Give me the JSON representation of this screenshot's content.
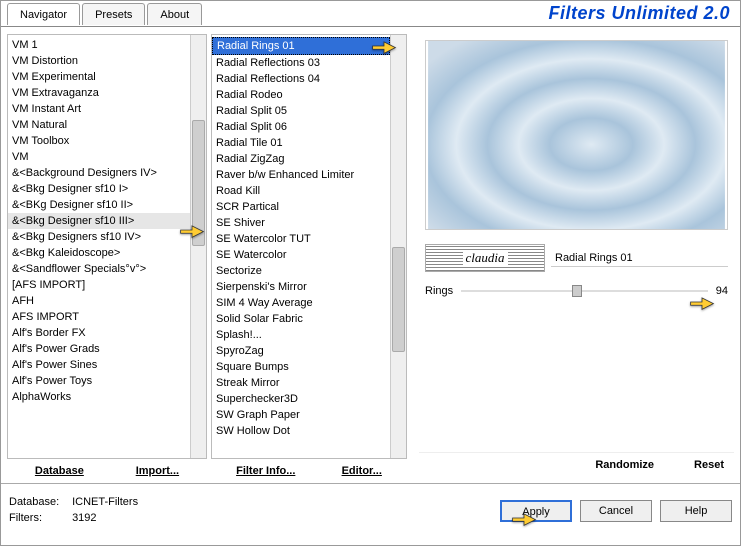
{
  "app": {
    "title": "Filters Unlimited 2.0"
  },
  "tabs": [
    "Navigator",
    "Presets",
    "About"
  ],
  "category_list": [
    "VM 1",
    "VM Distortion",
    "VM Experimental",
    "VM Extravaganza",
    "VM Instant Art",
    "VM Natural",
    "VM Toolbox",
    "VM",
    "&<Background Designers IV>",
    "&<Bkg Designer sf10 I>",
    "&<BKg Designer sf10 II>",
    "&<Bkg Designer sf10 III>",
    "&<Bkg Designers sf10 IV>",
    "&<Bkg Kaleidoscope>",
    "&<Sandflower Specials°v°>",
    "[AFS IMPORT]",
    "AFH",
    "AFS IMPORT",
    "Alf's Border FX",
    "Alf's Power Grads",
    "Alf's Power Sines",
    "Alf's Power Toys",
    "AlphaWorks"
  ],
  "category_highlight": "&<Bkg Designer sf10 III>",
  "filter_list": [
    "Radial  Rings 01",
    "Radial Reflections 03",
    "Radial Reflections 04",
    "Radial Rodeo",
    "Radial Split 05",
    "Radial Split 06",
    "Radial Tile 01",
    "Radial ZigZag",
    "Raver b/w Enhanced Limiter",
    "Road Kill",
    "SCR  Partical",
    "SE Shiver",
    "SE Watercolor TUT",
    "SE Watercolor",
    "Sectorize",
    "Sierpenski's Mirror",
    "SIM 4 Way Average",
    "Solid Solar Fabric",
    "Splash!...",
    "SpyroZag",
    "Square Bumps",
    "Streak Mirror",
    "Superchecker3D",
    "SW Graph Paper",
    "SW Hollow Dot"
  ],
  "filter_selected": "Radial  Rings 01",
  "buttons": {
    "database": "Database",
    "import": "Import...",
    "filter_info": "Filter Info...",
    "editor": "Editor...",
    "randomize": "Randomize",
    "reset": "Reset",
    "apply": "Apply",
    "cancel": "Cancel",
    "help": "Help"
  },
  "right": {
    "filter_name": "Radial  Rings 01",
    "param_label": "Rings",
    "param_value": "94",
    "watermark": "claudia"
  },
  "footer": {
    "db_label": "Database:",
    "db_value": "ICNET-Filters",
    "filters_label": "Filters:",
    "filters_value": "3192"
  }
}
